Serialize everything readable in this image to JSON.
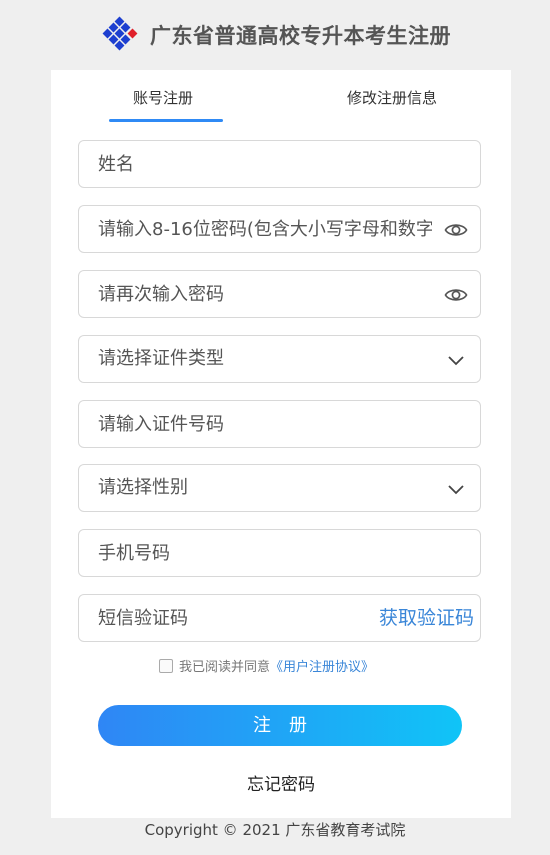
{
  "header": {
    "title": "广东省普通高校专升本考生注册"
  },
  "tabs": {
    "register": "账号注册",
    "modify": "修改注册信息"
  },
  "form": {
    "name_placeholder": "姓名",
    "password_placeholder": "请输入8-16位密码(包含大小写字母和数字)",
    "password_confirm_placeholder": "请再次输入密码",
    "id_type_label": "请选择证件类型",
    "id_number_placeholder": "请输入证件号码",
    "gender_label": "请选择性别",
    "phone_placeholder": "手机号码",
    "sms_placeholder": "短信验证码",
    "get_code_label": "获取验证码"
  },
  "agreement": {
    "text": "我已阅读并同意",
    "link": "《用户注册协议》"
  },
  "actions": {
    "register_label": "注册",
    "forgot_label": "忘记密码"
  },
  "footer": {
    "copyright": "Copyright © 2021 广东省教育考试院"
  },
  "colors": {
    "accent": "#2f8af5",
    "link": "#3a86d8",
    "button_gradient_start": "#2f86f5",
    "button_gradient_end": "#10c4f7",
    "logo_blue": "#1d3fd0",
    "logo_red": "#e0202a"
  }
}
